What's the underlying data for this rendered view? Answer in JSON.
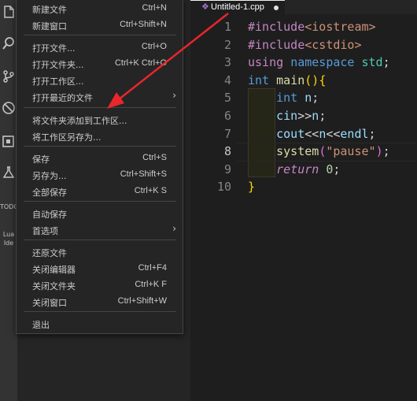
{
  "activity_bar": {
    "items": [
      {
        "icon": "files-icon"
      },
      {
        "icon": "search-icon"
      },
      {
        "icon": "source-control-icon"
      },
      {
        "icon": "debug-icon"
      },
      {
        "icon": "extensions-icon"
      },
      {
        "icon": "test-flask-icon"
      }
    ],
    "todo_label": "TODO",
    "lua_label_1": "Lua",
    "lua_label_2": "Ide"
  },
  "editor": {
    "tab": {
      "label": "Untitled-1.cpp",
      "dirty": true
    },
    "line_numbers": [
      "1",
      "2",
      "3",
      "4",
      "5",
      "6",
      "7",
      "8",
      "9",
      "10"
    ],
    "current_line": 8
  },
  "menu": {
    "items": [
      {
        "label": "新建文件",
        "shortcut": "Ctrl+N"
      },
      {
        "label": "新建窗口",
        "shortcut": "Ctrl+Shift+N"
      },
      {
        "label": "打开文件...",
        "shortcut": "Ctrl+O"
      },
      {
        "label": "打开文件夹...",
        "shortcut": "Ctrl+K Ctrl+O"
      },
      {
        "label": "打开工作区...",
        "shortcut": ""
      },
      {
        "label": "打开最近的文件",
        "shortcut": "",
        "submenu": true
      },
      {
        "label": "将文件夹添加到工作区...",
        "shortcut": ""
      },
      {
        "label": "将工作区另存为...",
        "shortcut": ""
      },
      {
        "label": "保存",
        "shortcut": "Ctrl+S"
      },
      {
        "label": "另存为...",
        "shortcut": "Ctrl+Shift+S"
      },
      {
        "label": "全部保存",
        "shortcut": "Ctrl+K S"
      },
      {
        "label": "自动保存",
        "shortcut": ""
      },
      {
        "label": "首选项",
        "shortcut": "",
        "submenu": true
      },
      {
        "label": "还原文件",
        "shortcut": ""
      },
      {
        "label": "关闭编辑器",
        "shortcut": "Ctrl+F4"
      },
      {
        "label": "关闭文件夹",
        "shortcut": "Ctrl+K F"
      },
      {
        "label": "关闭窗口",
        "shortcut": "Ctrl+Shift+W"
      },
      {
        "label": "退出",
        "shortcut": ""
      }
    ],
    "submenu_arrow": "›"
  },
  "annotation": {
    "color": "#e8262c"
  }
}
